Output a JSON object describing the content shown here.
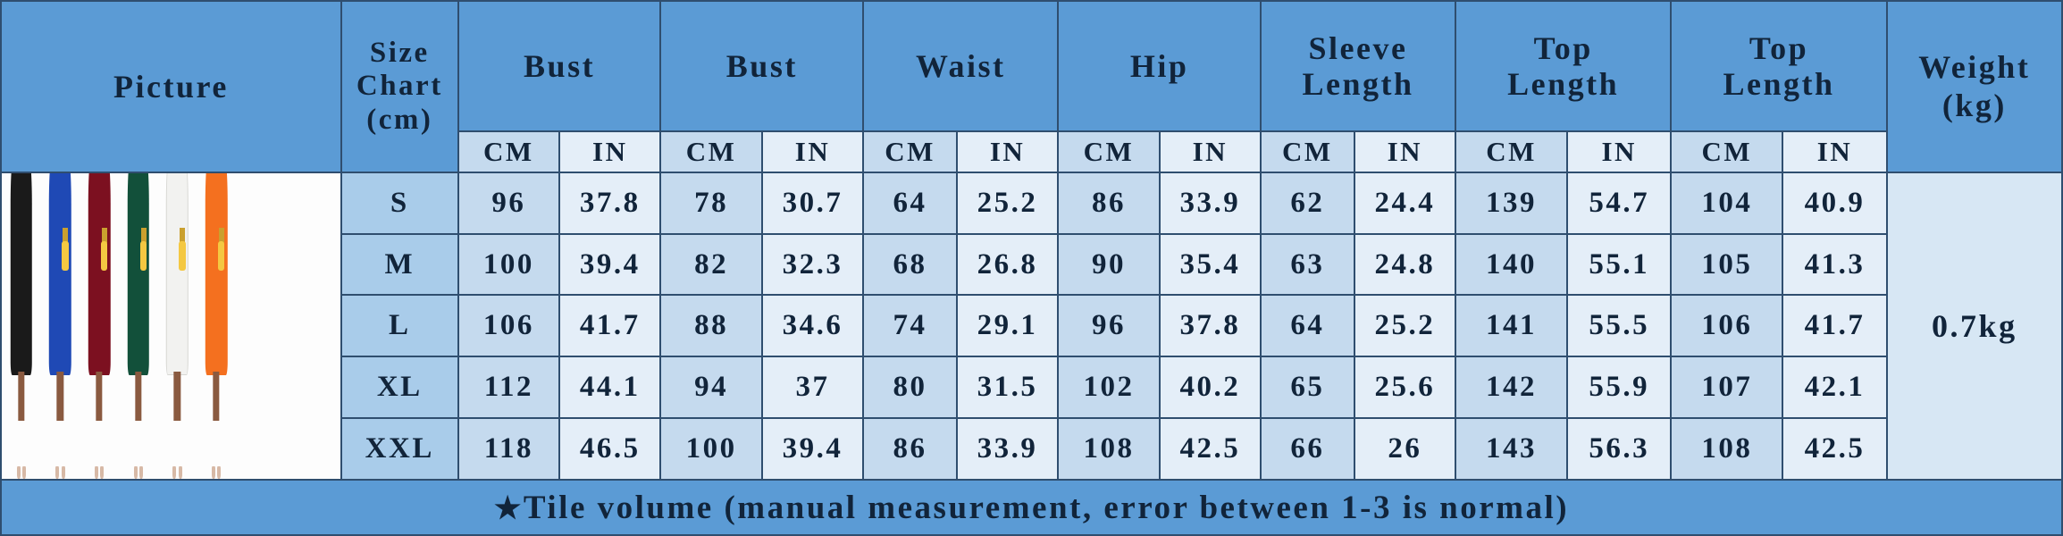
{
  "colors": {
    "header_bg": "#5b9bd5",
    "cm_col_bg": "#c5daee",
    "in_col_bg": "#e4eef8",
    "size_col_bg": "#a9ccea",
    "weight_bg": "#d7e7f4",
    "border": "#2f4e6f",
    "text": "#11243a"
  },
  "header": {
    "picture": "Picture",
    "size_chart_line1": "Size",
    "size_chart_line2": "Chart",
    "size_chart_line3": "(cm)",
    "groups": [
      {
        "name": "Bust",
        "line1": "Bust",
        "line2": ""
      },
      {
        "name": "Bust",
        "line1": "Bust",
        "line2": ""
      },
      {
        "name": "Waist",
        "line1": "Waist",
        "line2": ""
      },
      {
        "name": "Hip",
        "line1": "Hip",
        "line2": ""
      },
      {
        "name": "Sleeve Length",
        "line1": "Sleeve",
        "line2": "Length"
      },
      {
        "name": "Top Length",
        "line1": "Top",
        "line2": "Length"
      },
      {
        "name": "Top Length",
        "line1": "Top",
        "line2": "Length"
      }
    ],
    "weight_line1": "Weight",
    "weight_line2": "(kg)",
    "unit_cm": "CM",
    "unit_in": "IN"
  },
  "rows": [
    {
      "size": "S",
      "values": [
        "96",
        "37.8",
        "78",
        "30.7",
        "64",
        "25.2",
        "86",
        "33.9",
        "62",
        "24.4",
        "139",
        "54.7",
        "104",
        "40.9"
      ]
    },
    {
      "size": "M",
      "values": [
        "100",
        "39.4",
        "82",
        "32.3",
        "68",
        "26.8",
        "90",
        "35.4",
        "63",
        "24.8",
        "140",
        "55.1",
        "105",
        "41.3"
      ]
    },
    {
      "size": "L",
      "values": [
        "106",
        "41.7",
        "88",
        "34.6",
        "74",
        "29.1",
        "96",
        "37.8",
        "64",
        "25.2",
        "141",
        "55.5",
        "106",
        "41.7"
      ]
    },
    {
      "size": "XL",
      "values": [
        "112",
        "44.1",
        "94",
        "37",
        "80",
        "31.5",
        "102",
        "40.2",
        "65",
        "25.6",
        "142",
        "55.9",
        "107",
        "42.1"
      ]
    },
    {
      "size": "XXL",
      "values": [
        "118",
        "46.5",
        "100",
        "39.4",
        "86",
        "33.9",
        "108",
        "42.5",
        "66",
        "26",
        "143",
        "56.3",
        "108",
        "42.5"
      ]
    }
  ],
  "weight": "0.7kg",
  "footer": {
    "star": "★",
    "text": "Tile volume (manual measurement, error between 1-3 is normal)"
  },
  "picture": {
    "label": "product-photo-six-models",
    "models": [
      {
        "dress_color": "#1a1a1a",
        "name": "model-black-dress"
      },
      {
        "dress_color": "#1f49b5",
        "name": "model-blue-dress"
      },
      {
        "dress_color": "#7c1020",
        "name": "model-burgundy-dress"
      },
      {
        "dress_color": "#12503a",
        "name": "model-green-dress"
      },
      {
        "dress_color": "#f2f2f0",
        "name": "model-white-dress"
      },
      {
        "dress_color": "#f4701f",
        "name": "model-orange-dress"
      }
    ]
  }
}
